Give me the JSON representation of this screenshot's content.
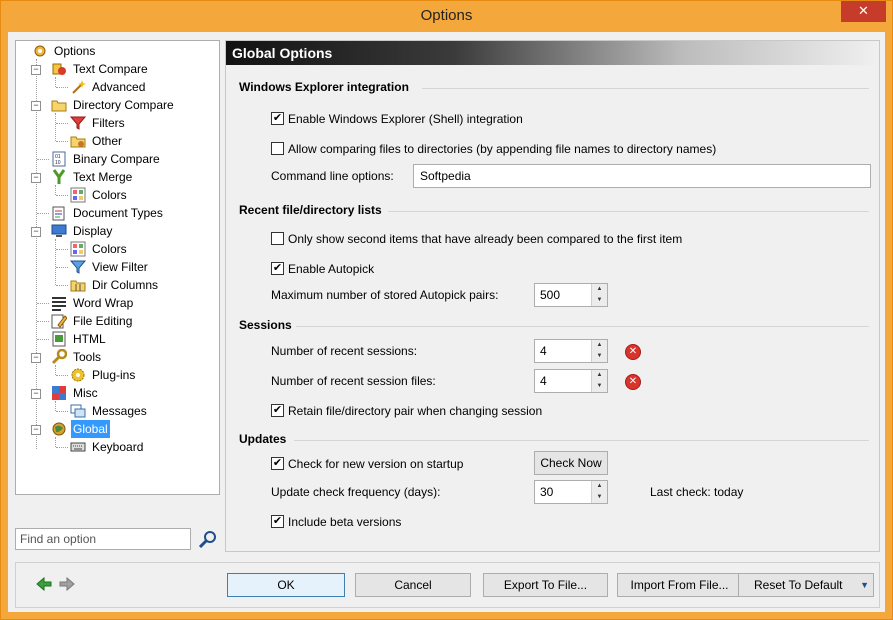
{
  "window": {
    "title": "Options",
    "close_glyph": "✕"
  },
  "tree": {
    "items": [
      {
        "label": "Options",
        "icon": "options-gear-icon"
      },
      {
        "label": "Text Compare",
        "icon": "text-compare-icon"
      },
      {
        "label": "Advanced",
        "icon": "magic-wand-icon"
      },
      {
        "label": "Directory Compare",
        "icon": "folder-compare-icon"
      },
      {
        "label": "Filters",
        "icon": "filter-icon"
      },
      {
        "label": "Other",
        "icon": "folder-gear-icon"
      },
      {
        "label": "Binary Compare",
        "icon": "binary-icon"
      },
      {
        "label": "Text Merge",
        "icon": "merge-icon"
      },
      {
        "label": "Colors",
        "icon": "color-grid-icon"
      },
      {
        "label": "Document Types",
        "icon": "document-types-icon"
      },
      {
        "label": "Display",
        "icon": "monitor-icon"
      },
      {
        "label": "Colors",
        "icon": "color-grid-icon"
      },
      {
        "label": "View Filter",
        "icon": "funnel-icon"
      },
      {
        "label": "Dir Columns",
        "icon": "columns-icon"
      },
      {
        "label": "Word Wrap",
        "icon": "word-wrap-icon"
      },
      {
        "label": "File Editing",
        "icon": "edit-pencil-icon"
      },
      {
        "label": "HTML",
        "icon": "html-icon"
      },
      {
        "label": "Tools",
        "icon": "wrench-icon"
      },
      {
        "label": "Plug-ins",
        "icon": "plugin-gear-icon"
      },
      {
        "label": "Misc",
        "icon": "misc-icon"
      },
      {
        "label": "Messages",
        "icon": "messages-icon"
      },
      {
        "label": "Global",
        "icon": "globe-icon"
      },
      {
        "label": "Keyboard",
        "icon": "keyboard-icon"
      }
    ],
    "selected": "Global",
    "find_placeholder": "Find an option"
  },
  "panel": {
    "header": "Global Options",
    "sections": {
      "explorer": {
        "title": "Windows Explorer integration",
        "enable_shell": {
          "label": "Enable Windows Explorer (Shell) integration",
          "checked": true
        },
        "allow_files_dirs": {
          "label": "Allow comparing files to directories (by appending file names to directory names)",
          "checked": false
        },
        "command_line_label": "Command line options:",
        "command_line_value": "Softpedia"
      },
      "recent": {
        "title": "Recent file/directory lists",
        "only_second": {
          "label": "Only show second items that have already been compared to the first item",
          "checked": false
        },
        "autopick": {
          "label": "Enable Autopick",
          "checked": true
        },
        "max_pairs_label": "Maximum number of stored Autopick pairs:",
        "max_pairs_value": "500"
      },
      "sessions": {
        "title": "Sessions",
        "recent_sessions_label": "Number of recent sessions:",
        "recent_sessions_value": "4",
        "recent_files_label": "Number of recent session files:",
        "recent_files_value": "4",
        "retain": {
          "label": "Retain file/directory pair when changing session",
          "checked": true
        }
      },
      "updates": {
        "title": "Updates",
        "check_startup": {
          "label": "Check for new version on startup",
          "checked": true
        },
        "check_now": "Check Now",
        "frequency_label": "Update check frequency (days):",
        "frequency_value": "30",
        "last_check": "Last check: today",
        "beta": {
          "label": "Include beta versions",
          "checked": true
        }
      }
    }
  },
  "buttons": {
    "ok": "OK",
    "cancel": "Cancel",
    "export": "Export To File...",
    "import": "Import From File...",
    "reset": "Reset To Default"
  },
  "glyphs": {
    "check": "✔",
    "up": "▲",
    "down": "▼",
    "clear": "✕",
    "dropdown": "▼"
  },
  "colors": {
    "accent": "#f4a73a",
    "selection": "#3399ff",
    "close": "#c73b2a"
  }
}
